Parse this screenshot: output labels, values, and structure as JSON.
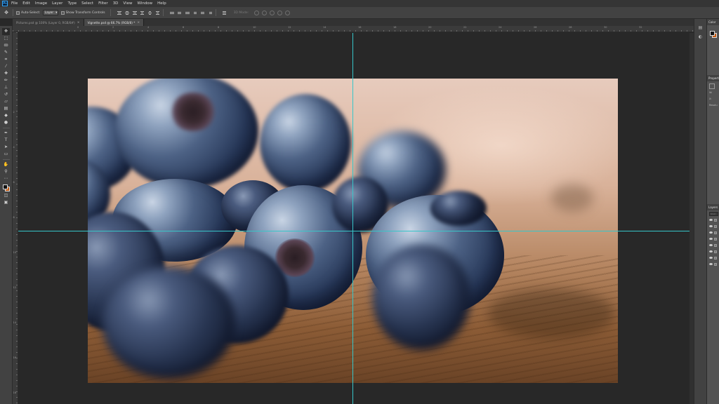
{
  "app": {
    "logo_text": "Ps"
  },
  "menu": {
    "items": [
      "File",
      "Edit",
      "Image",
      "Layer",
      "Type",
      "Select",
      "Filter",
      "3D",
      "View",
      "Window",
      "Help"
    ]
  },
  "options_bar": {
    "auto_select_label": "Auto-Select:",
    "auto_select_value": "Layer",
    "transform_label": "Show Transform Controls",
    "mode_3d_label": "3D Mode:"
  },
  "tabs": [
    {
      "label": "Pictures.psd @ 100% (Layer 0, RGB/8#)",
      "close": "×"
    },
    {
      "label": "Vignette.psd @ 66.7% (RGB/8) *",
      "close": "×"
    }
  ],
  "ruler": {
    "top_numbers": [
      "0",
      "2",
      "4",
      "6",
      "8",
      "10",
      "12",
      "14",
      "16",
      "18",
      "20",
      "22",
      "24",
      "26",
      "28",
      "30",
      "32"
    ],
    "left_numbers": [
      "0",
      "2",
      "4",
      "6",
      "8",
      "10",
      "12",
      "14",
      "16",
      "18"
    ]
  },
  "panels": {
    "color_title": "Color",
    "properties_title": "Properties",
    "properties_rows": [
      "W:",
      "X:",
      "Resolu"
    ],
    "layers_title": "Layers",
    "layers_search": "Kind"
  },
  "colors": {
    "foreground": "#111111",
    "background": "#c35a12",
    "guide": "#37c6c9"
  },
  "toolbar_icons": [
    "move-icon",
    "marquee-icon",
    "lasso-icon",
    "quick-select-icon",
    "crop-icon",
    "eyedropper-icon",
    "healing-icon",
    "brush-icon",
    "clone-stamp-icon",
    "history-brush-icon",
    "eraser-icon",
    "gradient-icon",
    "blur-icon",
    "dodge-icon",
    "pen-icon",
    "type-icon",
    "path-select-icon",
    "rectangle-icon",
    "hand-icon",
    "zoom-icon",
    "more-icon"
  ]
}
